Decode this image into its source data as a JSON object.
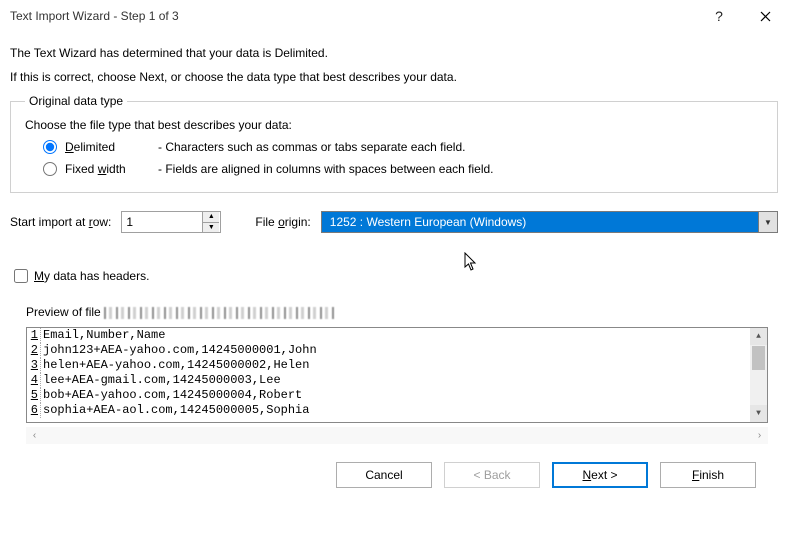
{
  "title": "Text Import Wizard - Step 1 of 3",
  "intro": {
    "line1": "The Text Wizard has determined that your data is Delimited.",
    "line2": "If this is correct, choose Next, or choose the data type that best describes your data."
  },
  "group": {
    "legend": "Original data type",
    "prompt": "Choose the file type that best describes your data:",
    "delimited": {
      "label_ul": "D",
      "label_rest": "elimited",
      "desc": "- Characters such as commas or tabs separate each field."
    },
    "fixed": {
      "label": "Fixed ",
      "label_ul": "w",
      "label_rest2": "idth",
      "desc": "- Fields are aligned in columns with spaces between each field."
    }
  },
  "startRow": {
    "label": "Start import at ",
    "label_ul": "r",
    "label_rest": "ow:",
    "value": "1"
  },
  "fileOrigin": {
    "label": "File ",
    "label_ul": "o",
    "label_rest": "rigin:",
    "selected": "1252 : Western European (Windows)"
  },
  "headersCheck": {
    "label_ul": "M",
    "label_rest": "y data has headers."
  },
  "previewLabel": "Preview of file ",
  "previewLines": [
    "Email,Number,Name",
    "john123+AEA-yahoo.com,14245000001,John",
    "helen+AEA-yahoo.com,14245000002,Helen",
    "lee+AEA-gmail.com,14245000003,Lee",
    "bob+AEA-yahoo.com,14245000004,Robert",
    "sophia+AEA-aol.com,14245000005,Sophia"
  ],
  "buttons": {
    "cancel": "Cancel",
    "back": "< Back",
    "next_ul": "N",
    "next_rest": "ext >",
    "finish_ul": "F",
    "finish_rest": "inish"
  }
}
